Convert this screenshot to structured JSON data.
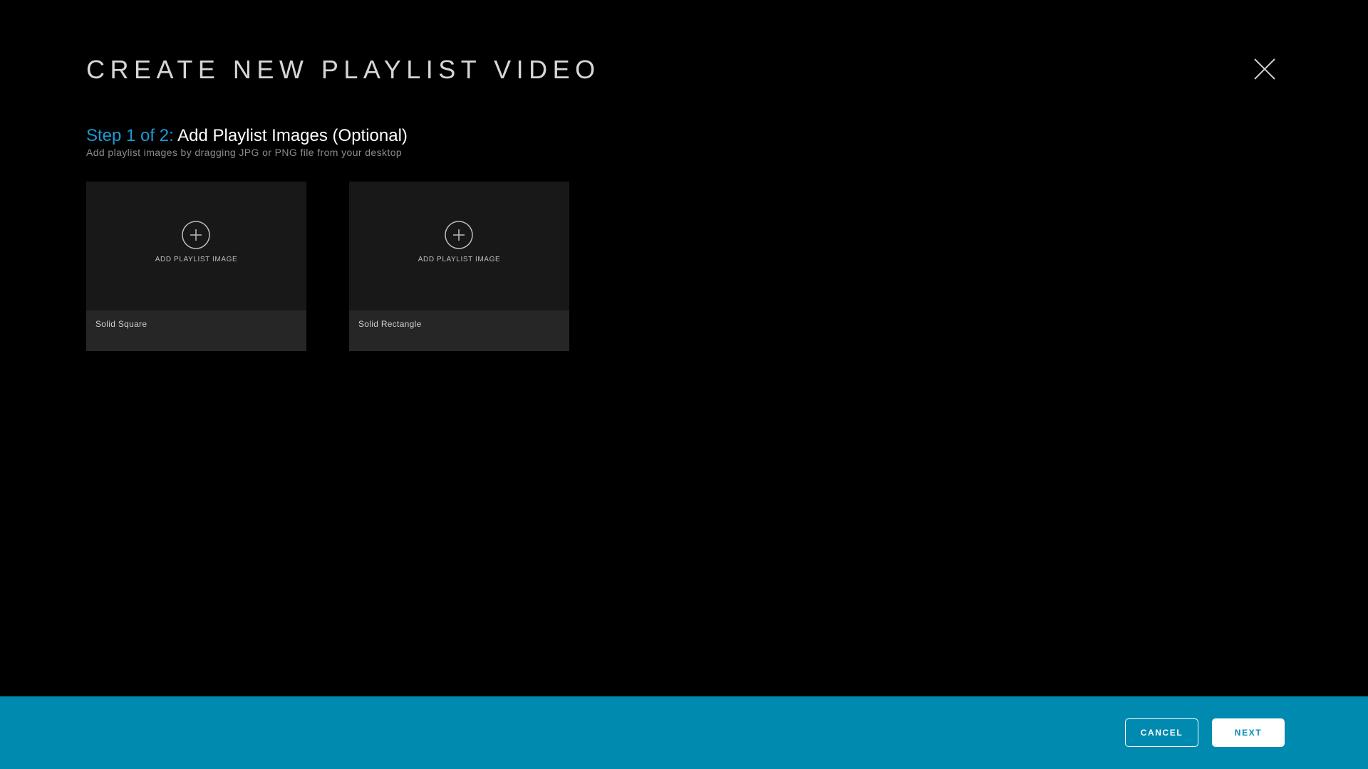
{
  "modal": {
    "title": "CREATE NEW PLAYLIST VIDEO",
    "close_icon": "close-icon"
  },
  "step": {
    "prefix": "Step 1 of 2:",
    "title": "Add Playlist Images (Optional)",
    "description": "Add playlist images by dragging JPG or PNG file from your desktop"
  },
  "cards": [
    {
      "add_label": "ADD PLAYLIST IMAGE",
      "name": "Solid Square",
      "icon": "plus-circle-icon"
    },
    {
      "add_label": "ADD PLAYLIST IMAGE",
      "name": "Solid Rectangle",
      "icon": "plus-circle-icon"
    }
  ],
  "footer": {
    "cancel_label": "CANCEL",
    "next_label": "NEXT"
  },
  "colors": {
    "background": "#000000",
    "accent": "#1a9ad6",
    "footer_bar": "#008ab0",
    "card": "#181818",
    "card_footer": "#262626"
  }
}
